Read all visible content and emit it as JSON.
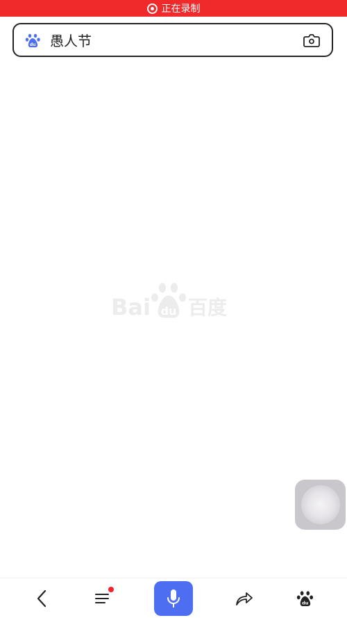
{
  "status_bar": {
    "recording_label": "正在录制",
    "color": "#f02a2a"
  },
  "search": {
    "query": "愚人节",
    "logo_icon": "baidu-paw-icon",
    "camera_icon": "camera-icon"
  },
  "watermark": {
    "latin": "Bai",
    "du": "du",
    "chinese": "百度"
  },
  "floating_assistant": {
    "icon": "assistant-orb-icon"
  },
  "bottom_nav": {
    "items": [
      {
        "icon": "back-icon"
      },
      {
        "icon": "menu-icon",
        "has_badge": true
      },
      {
        "icon": "microphone-icon"
      },
      {
        "icon": "share-icon"
      },
      {
        "icon": "baidu-paw-icon"
      }
    ],
    "accent": "#4e6ef2"
  }
}
